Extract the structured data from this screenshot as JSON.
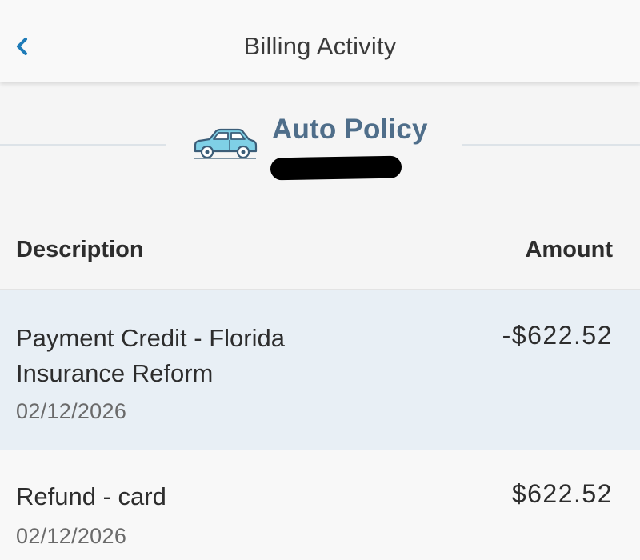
{
  "header": {
    "title": "Billing Activity",
    "back_icon": "chevron-left-icon",
    "accent_color": "#1e7bb8"
  },
  "policy": {
    "title": "Auto Policy",
    "icon": "car-icon",
    "title_color": "#4f6e8a",
    "number_redacted": true
  },
  "table": {
    "columns": {
      "description": "Description",
      "amount": "Amount"
    },
    "rows": [
      {
        "description": "Payment Credit - Florida Insurance Reform",
        "date": "02/12/2026",
        "amount": "-$622.52",
        "highlighted": true
      },
      {
        "description": "Refund - card",
        "date": "02/12/2026",
        "amount": "$622.52",
        "highlighted": false
      }
    ]
  }
}
